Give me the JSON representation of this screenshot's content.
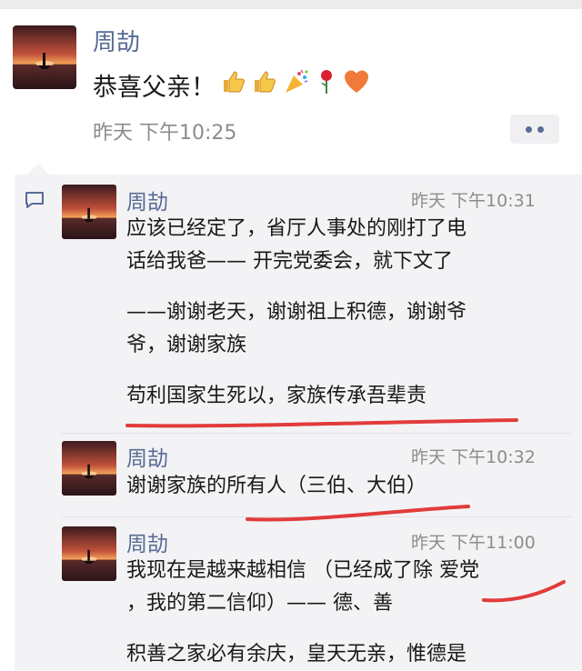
{
  "post": {
    "author": "周劼",
    "text": "恭喜父亲！",
    "emojis": [
      "thumbs-up-icon",
      "thumbs-up-icon",
      "party-popper-icon",
      "rose-icon",
      "heart-icon"
    ],
    "time": "昨天 下午10:25"
  },
  "comments": [
    {
      "author": "周劼",
      "time": "昨天 下午10:31",
      "lines": [
        "应该已经定了，省厅人事处的刚打了电",
        "话给我爸—— 开完党委会，就下文了",
        "",
        "——谢谢老天，谢谢祖上积德，谢谢爷",
        "爷，谢谢家族",
        "",
        "苟利国家生死以，家族传承吾辈责"
      ]
    },
    {
      "author": "周劼",
      "time": "昨天 下午10:32",
      "lines": [
        "谢谢家族的所有人（三伯、大伯）"
      ]
    },
    {
      "author": "周劼",
      "time": "昨天 下午11:00",
      "lines": [
        "我现在是越来越相信 （已经成了除 爱党",
        "，我的第二信仰）—— 德、善",
        "",
        "积善之家必有余庆，皇天无亲，惟德是"
      ]
    }
  ],
  "colors": {
    "name_link": "#576b95",
    "comment_bg": "#f3f3f5",
    "timestamp": "#8c8c8c",
    "red_ink": "#e23b3b"
  }
}
